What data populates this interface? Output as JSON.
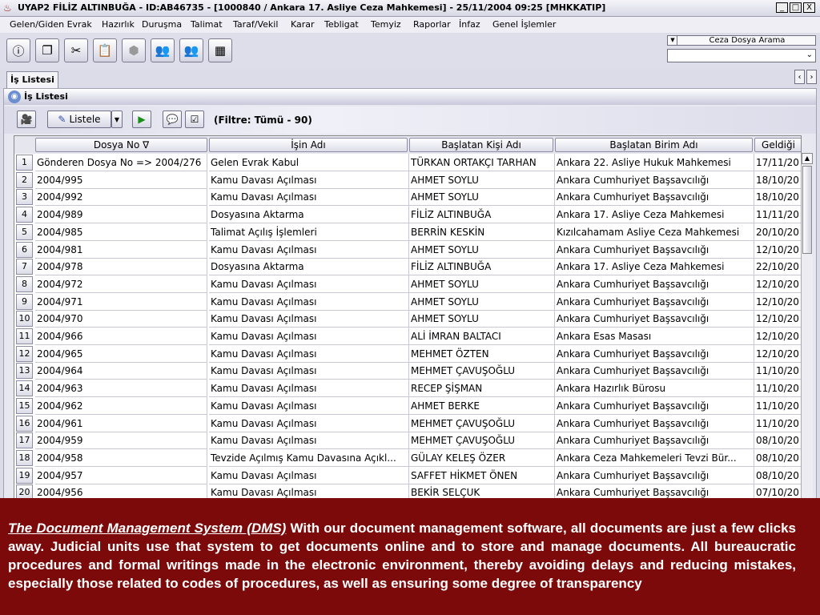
{
  "window": {
    "title": "UYAP2  FİLİZ ALTINBUĞA - ID:AB46735 - [1000840 / Ankara 17. Asliye Ceza Mahkemesi] - 25/11/2004 09:25 [MHKKATIP]",
    "min": "_",
    "max": "□",
    "close": "X"
  },
  "menu": [
    "Gelen/Giden Evrak",
    "Hazırlık",
    "Duruşma",
    "Talimat",
    "Taraf/Vekil",
    "Karar",
    "Tebligat",
    "Temyiz",
    "Raporlar",
    "İnfaz",
    "Genel İşlemler"
  ],
  "search": {
    "label": "Ceza Dosya Arama",
    "value": ""
  },
  "tab": {
    "label": "İş Listesi"
  },
  "panel": {
    "title": "İş Listesi"
  },
  "subtoolbar": {
    "list_label": "Listele",
    "filter_text": "(Filtre: Tümü - 90)"
  },
  "grid": {
    "headers": [
      "Dosya No ∇",
      "İşin Adı",
      "Başlatan Kişi Adı",
      "Başlatan Birim Adı",
      "Geldiği"
    ],
    "rows": [
      [
        "1",
        "Gönderen Dosya No => 2004/276",
        "Gelen Evrak Kabul",
        "TÜRKAN ORTAKÇI TARHAN",
        "Ankara 22. Asliye Hukuk Mahkemesi",
        "17/11/20"
      ],
      [
        "2",
        "2004/995",
        "Kamu Davası Açılması",
        "AHMET SOYLU",
        "Ankara Cumhuriyet Başsavcılığı",
        "18/10/20"
      ],
      [
        "3",
        "2004/992",
        "Kamu Davası Açılması",
        "AHMET SOYLU",
        "Ankara Cumhuriyet Başsavcılığı",
        "18/10/20"
      ],
      [
        "4",
        "2004/989",
        "Dosyasına Aktarma",
        "FİLİZ ALTINBUĞA",
        "Ankara 17. Asliye Ceza Mahkemesi",
        "11/11/20"
      ],
      [
        "5",
        "2004/985",
        "Talimat Açılış İşlemleri",
        "BERRİN KESKİN",
        "Kızılcahamam Asliye Ceza Mahkemesi",
        "20/10/20"
      ],
      [
        "6",
        "2004/981",
        "Kamu Davası Açılması",
        "AHMET SOYLU",
        "Ankara Cumhuriyet Başsavcılığı",
        "12/10/20"
      ],
      [
        "7",
        "2004/978",
        "Dosyasına Aktarma",
        "FİLİZ ALTINBUĞA",
        "Ankara 17. Asliye Ceza Mahkemesi",
        "22/10/20"
      ],
      [
        "8",
        "2004/972",
        "Kamu Davası Açılması",
        "AHMET SOYLU",
        "Ankara Cumhuriyet Başsavcılığı",
        "12/10/20"
      ],
      [
        "9",
        "2004/971",
        "Kamu Davası Açılması",
        "AHMET SOYLU",
        "Ankara Cumhuriyet Başsavcılığı",
        "12/10/20"
      ],
      [
        "10",
        "2004/970",
        "Kamu Davası Açılması",
        "AHMET SOYLU",
        "Ankara Cumhuriyet Başsavcılığı",
        "12/10/20"
      ],
      [
        "11",
        "2004/966",
        "Kamu Davası Açılması",
        "ALİ İMRAN BALTACI",
        "Ankara Esas Masası",
        "12/10/20"
      ],
      [
        "12",
        "2004/965",
        "Kamu Davası Açılması",
        "MEHMET ÖZTEN",
        "Ankara Cumhuriyet Başsavcılığı",
        "12/10/20"
      ],
      [
        "13",
        "2004/964",
        "Kamu Davası Açılması",
        "MEHMET ÇAVUŞOĞLU",
        "Ankara Cumhuriyet Başsavcılığı",
        "11/10/20"
      ],
      [
        "14",
        "2004/963",
        "Kamu Davası Açılması",
        "RECEP ŞİŞMAN",
        "Ankara Hazırlık Bürosu",
        "11/10/20"
      ],
      [
        "15",
        "2004/962",
        "Kamu Davası Açılması",
        "AHMET BERKE",
        "Ankara Cumhuriyet Başsavcılığı",
        "11/10/20"
      ],
      [
        "16",
        "2004/961",
        "Kamu Davası Açılması",
        "MEHMET ÇAVUŞOĞLU",
        "Ankara Cumhuriyet Başsavcılığı",
        "11/10/20"
      ],
      [
        "17",
        "2004/959",
        "Kamu Davası Açılması",
        "MEHMET ÇAVUŞOĞLU",
        "Ankara Cumhuriyet Başsavcılığı",
        "08/10/20"
      ],
      [
        "18",
        "2004/958",
        "Tevzide Açılmış Kamu Davasına Açıkl...",
        "GÜLAY KELEŞ ÖZER",
        "Ankara Ceza Mahkemeleri Tevzi Bür...",
        "08/10/20"
      ],
      [
        "19",
        "2004/957",
        "Kamu Davası Açılması",
        "SAFFET HİKMET ÖNEN",
        "Ankara Cumhuriyet Başsavcılığı",
        "08/10/20"
      ],
      [
        "20",
        "2004/956",
        "Kamu Davası Açılması",
        "BEKİR SELÇUK",
        "Ankara Cumhuriyet Başsavcılığı",
        "07/10/20"
      ]
    ]
  },
  "caption": {
    "heading": "The Document Management System (DMS)",
    "body": " With our document management software, all documents are just a few clicks away.  Judicial units use that system to get documents online and to store and manage documents. All bureaucratic procedures and formal writings made in the electronic environment, thereby avoiding delays and reducing mistakes, especially those related to codes of procedures, as well as ensuring some degree of transparency"
  }
}
